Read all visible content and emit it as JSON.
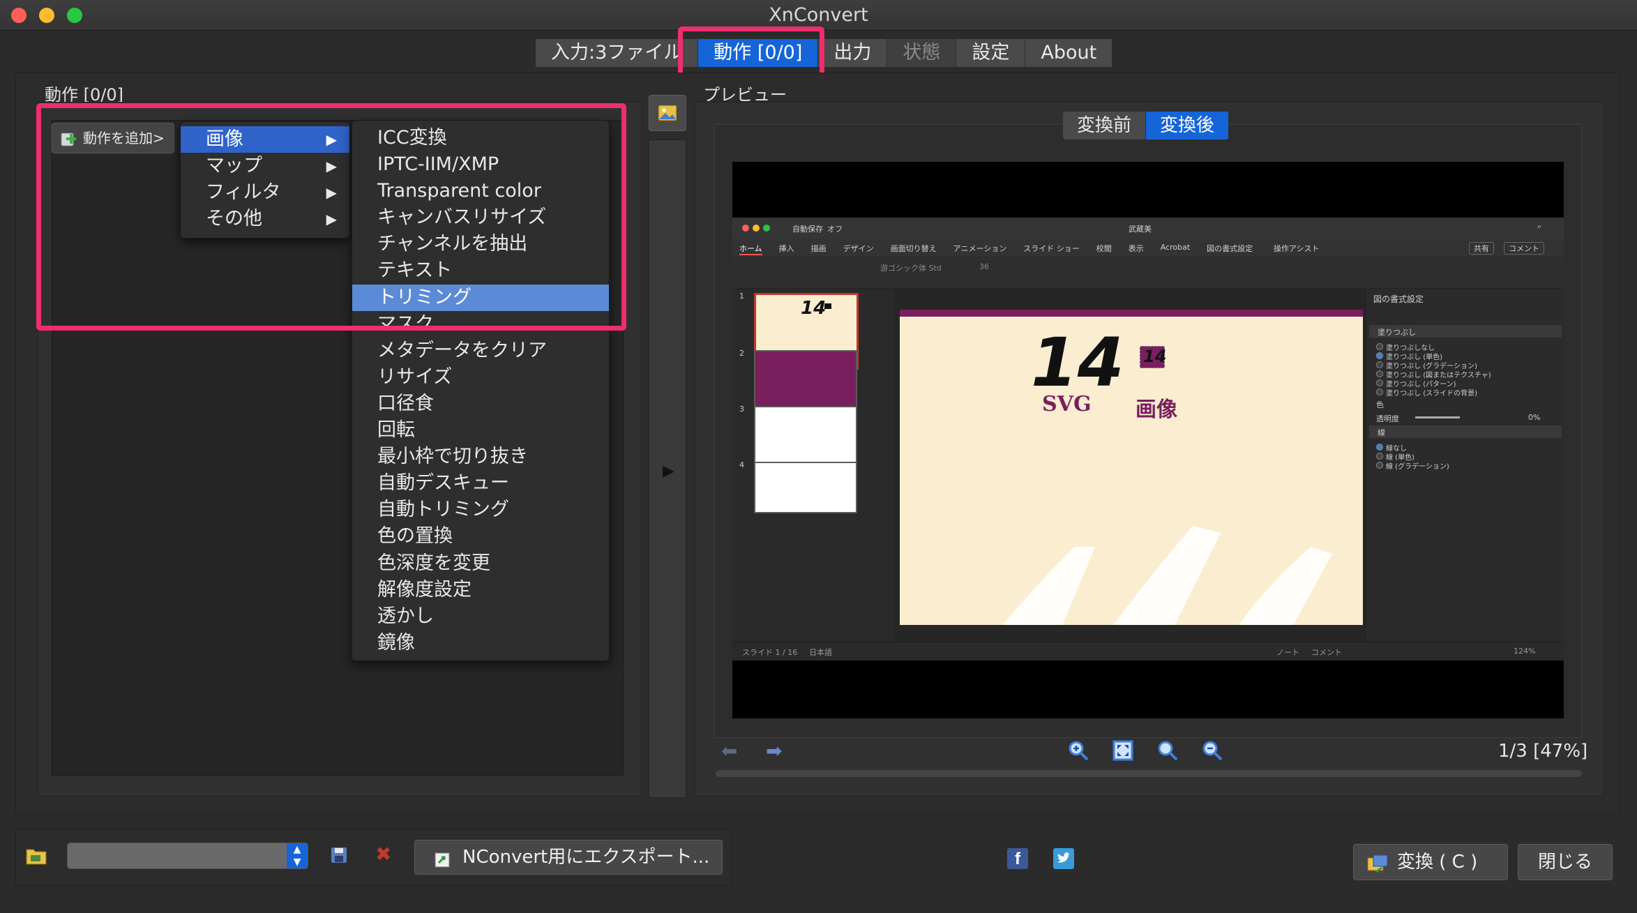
{
  "window": {
    "title": "XnConvert"
  },
  "tabs": [
    {
      "label": "入力:3ファイル",
      "state": "normal"
    },
    {
      "label": "動作 [0/0]",
      "state": "active"
    },
    {
      "label": "出力",
      "state": "normal"
    },
    {
      "label": "状態",
      "state": "disabled"
    },
    {
      "label": "設定",
      "state": "normal"
    },
    {
      "label": "About",
      "state": "normal"
    }
  ],
  "actions": {
    "label": "動作 [0/0]",
    "add_button": "動作を追加>",
    "category_menu": [
      {
        "label": "画像",
        "selected": true
      },
      {
        "label": "マップ",
        "selected": false
      },
      {
        "label": "フィルタ",
        "selected": false
      },
      {
        "label": "その他",
        "selected": false
      }
    ],
    "image_menu": [
      {
        "label": "ICC変換",
        "selected": false
      },
      {
        "label": "IPTC-IIM/XMP",
        "selected": false
      },
      {
        "label": "Transparent color",
        "selected": false
      },
      {
        "label": "キャンバスリサイズ",
        "selected": false
      },
      {
        "label": "チャンネルを抽出",
        "selected": false
      },
      {
        "label": "テキスト",
        "selected": false
      },
      {
        "label": "トリミング",
        "selected": true
      },
      {
        "label": "マスク",
        "selected": false
      },
      {
        "label": "メタデータをクリア",
        "selected": false
      },
      {
        "label": "リサイズ",
        "selected": false
      },
      {
        "label": "口径食",
        "selected": false
      },
      {
        "label": "回転",
        "selected": false
      },
      {
        "label": "最小枠で切り抜き",
        "selected": false
      },
      {
        "label": "自動デスキュー",
        "selected": false
      },
      {
        "label": "自動トリミング",
        "selected": false
      },
      {
        "label": "色の置換",
        "selected": false
      },
      {
        "label": "色深度を変更",
        "selected": false
      },
      {
        "label": "解像度設定",
        "selected": false
      },
      {
        "label": "透かし",
        "selected": false
      },
      {
        "label": "鏡像",
        "selected": false
      }
    ]
  },
  "preview": {
    "label": "プレビュー",
    "toggle": {
      "before": "変換前",
      "after": "変換後"
    },
    "page_info": "1/3 [47%]",
    "image": {
      "ribbon_tabs": [
        "ホーム",
        "挿入",
        "描画",
        "デザイン",
        "画面切り替え",
        "アニメーション",
        "スライド ショー",
        "校閲",
        "表示",
        "Acrobat",
        "図の書式設定"
      ],
      "assist": "操作アシスト",
      "doc_title": "武蔵美",
      "autosave": "自動保存",
      "autosave_state": "オフ",
      "share": "共有",
      "comment": "コメント",
      "font_name": "游ゴシック体 Std",
      "font_size": "36",
      "slide_text": {
        "number": "14",
        "svg": "SVG",
        "image": "画像"
      },
      "thumb_nums": [
        "1",
        "2",
        "3",
        "4"
      ],
      "panel_title": "図の書式設定",
      "fill_header": "塗りつぶし",
      "fill_options": [
        "塗りつぶしなし",
        "塗りつぶし (単色)",
        "塗りつぶし (グラデーション)",
        "塗りつぶし (図またはテクスチャ)",
        "塗りつぶし (パターン)",
        "塗りつぶし (スライドの背景)"
      ],
      "color_label": "色",
      "transparency_label": "透明度",
      "transparency_value": "0%",
      "line_header": "線",
      "line_options": [
        "線なし",
        "線 (単色)",
        "線 (グラデーション)"
      ],
      "status_slide": "スライド 1 / 16",
      "status_lang": "日本語",
      "status_notes": "ノート",
      "status_comments": "コメント",
      "zoom": "124%",
      "colors": {
        "slide_bg": "#fbeed0",
        "accent": "#7a1f5e"
      }
    }
  },
  "bottom": {
    "export_button": "NConvert用にエクスポート...",
    "convert_button": "変換 ( C )",
    "close_button": "閉じる"
  }
}
